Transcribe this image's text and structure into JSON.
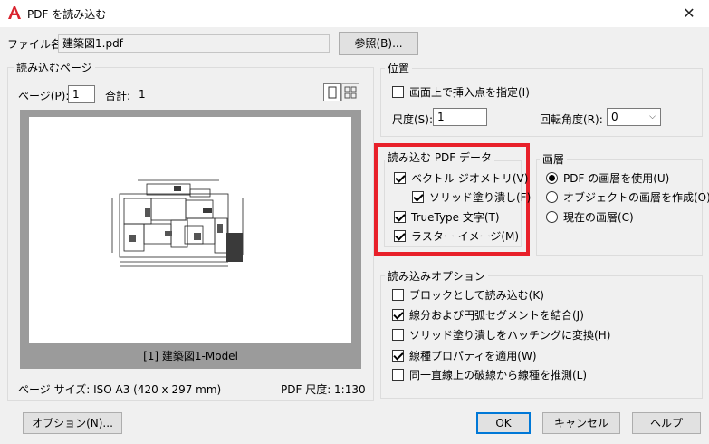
{
  "window": {
    "title": "PDF を読み込む",
    "close": "✕"
  },
  "file": {
    "label": "ファイル名:",
    "value": "建築図1.pdf",
    "browse_label": "参照(B)..."
  },
  "pages": {
    "group_title": "読み込むページ",
    "page_label": "ページ(P):",
    "page_value": "1",
    "total_label": "合計:",
    "total_value": "1",
    "preview_caption": "[1] 建築図1-Model",
    "page_size": "ページ サイズ: ISO A3 (420 x 297 mm)",
    "pdf_scale": "PDF 尺度: 1:130"
  },
  "position": {
    "group_title": "位置",
    "specify_onscreen": "画面上で挿入点を指定(I)",
    "scale_label": "尺度(S):",
    "scale_value": "1",
    "rotation_label": "回転角度(R):",
    "rotation_value": "0"
  },
  "pdf_data": {
    "group_title": "読み込む PDF データ",
    "vector": "ベクトル ジオメトリ(V)",
    "solid_fill": "ソリッド塗り潰し(F)",
    "truetype": "TrueType 文字(T)",
    "raster": "ラスター イメージ(M)"
  },
  "layers": {
    "group_title": "画層",
    "use_pdf": "PDF の画層を使用(U)",
    "create_object": "オブジェクトの画層を作成(O)",
    "current": "現在の画層(C)"
  },
  "import_options": {
    "group_title": "読み込みオプション",
    "as_block": "ブロックとして読み込む(K)",
    "join_segments": "線分および円弧セグメントを結合(J)",
    "solid_to_hatch": "ソリッド塗り潰しをハッチングに変換(H)",
    "apply_linetype": "線種プロパティを適用(W)",
    "infer_linetype": "同一直線上の破線から線種を推測(L)"
  },
  "buttons": {
    "options": "オプション(N)...",
    "ok": "OK",
    "cancel": "キャンセル",
    "help": "ヘルプ"
  }
}
